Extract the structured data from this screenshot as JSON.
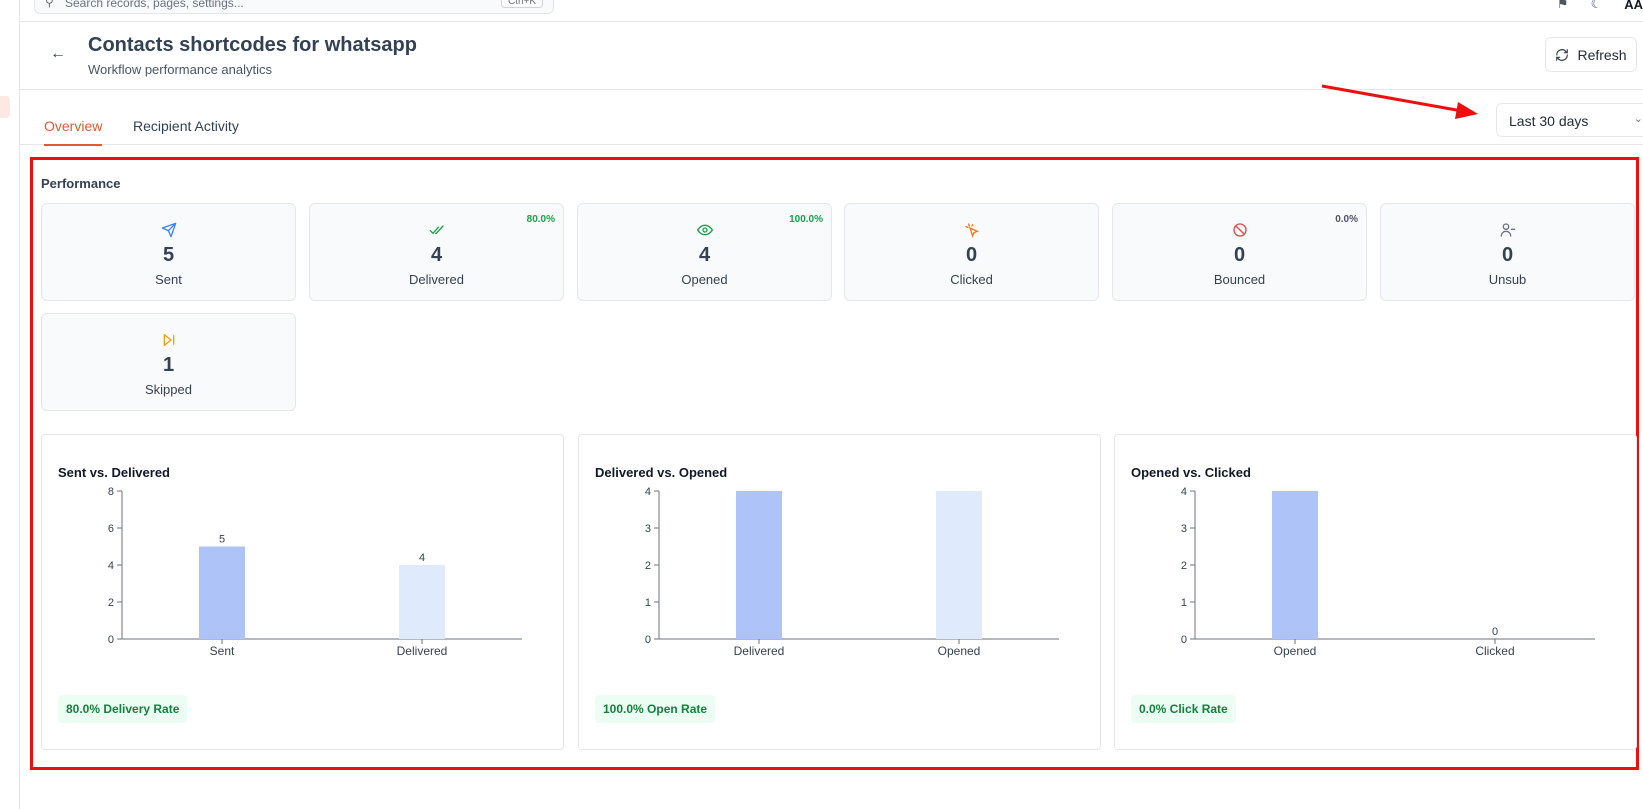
{
  "topbar": {
    "search_placeholder": "Search records, pages, settings...",
    "search_shortcut": "Ctrl+K",
    "user_initials": "AA"
  },
  "header": {
    "title": "Contacts shortcodes for whatsapp",
    "subtitle": "Workflow performance analytics",
    "refresh_label": "Refresh"
  },
  "tabs": [
    {
      "label": "Overview",
      "active": true
    },
    {
      "label": "Recipient Activity",
      "active": false
    }
  ],
  "date_range": {
    "selected": "Last 30 days"
  },
  "performance": {
    "label": "Performance",
    "stats": [
      {
        "key": "sent",
        "label": "Sent",
        "value": "5",
        "pct": "",
        "icon": "send-icon",
        "color": "#3b82f6"
      },
      {
        "key": "delivered",
        "label": "Delivered",
        "value": "4",
        "pct": "80.0%",
        "icon": "double-check-icon",
        "color": "#16a34a"
      },
      {
        "key": "opened",
        "label": "Opened",
        "value": "4",
        "pct": "100.0%",
        "icon": "eye-icon",
        "color": "#16a34a"
      },
      {
        "key": "clicked",
        "label": "Clicked",
        "value": "0",
        "pct": "",
        "icon": "pointer-click-icon",
        "color": "#f97316"
      },
      {
        "key": "bounced",
        "label": "Bounced",
        "value": "0",
        "pct": "0.0%",
        "icon": "ban-icon",
        "color": "#ef4444"
      },
      {
        "key": "unsub",
        "label": "Unsub",
        "value": "0",
        "pct": "",
        "icon": "user-minus-icon",
        "color": "#6b7280"
      },
      {
        "key": "skipped",
        "label": "Skipped",
        "value": "1",
        "pct": "",
        "icon": "skip-forward-icon",
        "color": "#f59e0b"
      }
    ]
  },
  "chart_data": [
    {
      "type": "bar",
      "title": "Sent vs. Delivered",
      "categories": [
        "Sent",
        "Delivered"
      ],
      "values": [
        5,
        4
      ],
      "colors": [
        "#aec4f8",
        "#dfeafd"
      ],
      "ylim": [
        0,
        8
      ],
      "yticks": [
        0,
        2,
        4,
        6,
        8
      ],
      "data_labels": [
        "5",
        "4"
      ],
      "rate_label": "80.0% Delivery Rate"
    },
    {
      "type": "bar",
      "title": "Delivered vs. Opened",
      "categories": [
        "Delivered",
        "Opened"
      ],
      "values": [
        4,
        4
      ],
      "colors": [
        "#aec4f8",
        "#dfeafd"
      ],
      "ylim": [
        0,
        4
      ],
      "yticks": [
        0,
        1,
        2,
        3,
        4
      ],
      "data_labels": [
        "",
        ""
      ],
      "rate_label": "100.0% Open Rate"
    },
    {
      "type": "bar",
      "title": "Opened vs. Clicked",
      "categories": [
        "Opened",
        "Clicked"
      ],
      "values": [
        4,
        0
      ],
      "colors": [
        "#aec4f8",
        "#dfeafd"
      ],
      "ylim": [
        0,
        4
      ],
      "yticks": [
        0,
        1,
        2,
        3,
        4
      ],
      "data_labels": [
        "",
        "0"
      ],
      "rate_label": "0.0% Click Rate"
    }
  ]
}
